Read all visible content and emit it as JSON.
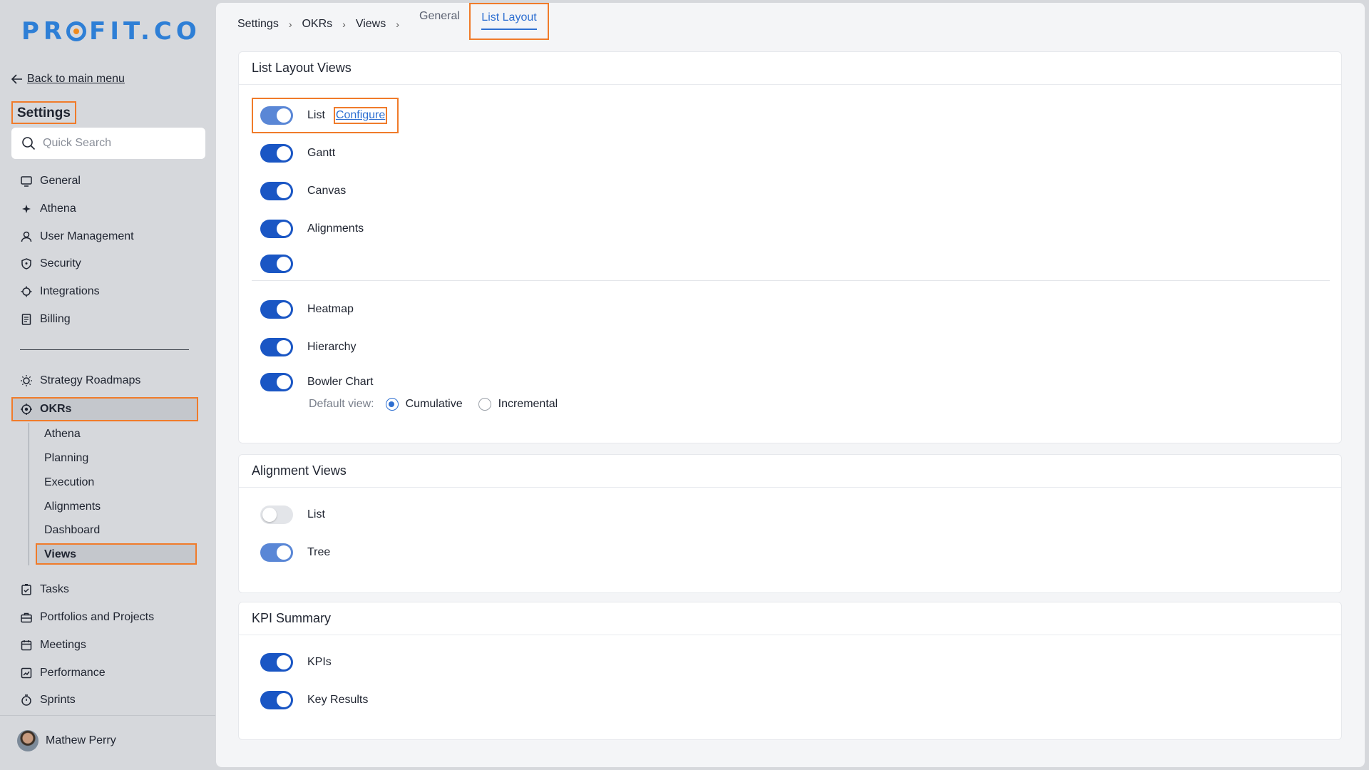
{
  "sidebar": {
    "logo": "PROFIT.CO",
    "back_link": "Back to main menu",
    "title": "Settings",
    "search_placeholder": "Quick Search",
    "items": [
      {
        "label": "General",
        "icon": "monitor-icon"
      },
      {
        "label": "Athena",
        "icon": "sparkle-icon"
      },
      {
        "label": "User Management",
        "icon": "user-icon"
      },
      {
        "label": "Security",
        "icon": "shield-icon"
      },
      {
        "label": "Integrations",
        "icon": "gear-icon"
      },
      {
        "label": "Billing",
        "icon": "receipt-icon"
      }
    ],
    "items2": [
      {
        "label": "Strategy Roadmaps",
        "icon": "bulb-icon"
      },
      {
        "label": "OKRs",
        "icon": "target-icon"
      }
    ],
    "okr_sub": [
      "Athena",
      "Planning",
      "Execution",
      "Alignments",
      "Dashboard",
      "Views"
    ],
    "items3": [
      {
        "label": "Tasks",
        "icon": "clipboard-check-icon"
      },
      {
        "label": "Portfolios and Projects",
        "icon": "briefcase-icon"
      },
      {
        "label": "Meetings",
        "icon": "calendar-icon"
      },
      {
        "label": "Performance",
        "icon": "chart-line-icon"
      },
      {
        "label": "Sprints",
        "icon": "stopwatch-icon"
      }
    ],
    "user": "Mathew Perry"
  },
  "breadcrumb": [
    "Settings",
    "OKRs",
    "Views"
  ],
  "tabs": {
    "general": "General",
    "list_layout": "List Layout"
  },
  "list_layout_views": {
    "title": "List Layout Views",
    "configure_label": "Configure",
    "items": [
      {
        "label": "List",
        "state": "on-light"
      },
      {
        "label": "Gantt",
        "state": "on"
      },
      {
        "label": "Canvas",
        "state": "on"
      },
      {
        "label": "Alignments",
        "state": "on"
      },
      {
        "label": "",
        "state": "on"
      },
      {
        "label": "Heatmap",
        "state": "on"
      },
      {
        "label": "Hierarchy",
        "state": "on"
      },
      {
        "label": "Bowler Chart",
        "state": "on"
      }
    ],
    "default_view_label": "Default view:",
    "options": [
      "Cumulative",
      "Incremental"
    ],
    "selected_option": "Cumulative"
  },
  "alignment_views": {
    "title": "Alignment Views",
    "items": [
      {
        "label": "List",
        "state": "off"
      },
      {
        "label": "Tree",
        "state": "on-light"
      }
    ]
  },
  "kpi_summary": {
    "title": "KPI Summary",
    "items": [
      {
        "label": "KPIs",
        "state": "on"
      },
      {
        "label": "Key Results",
        "state": "on"
      }
    ]
  },
  "colors": {
    "accent": "#1a56c4",
    "highlight": "#f07b2a",
    "link": "#2e6fd1"
  }
}
